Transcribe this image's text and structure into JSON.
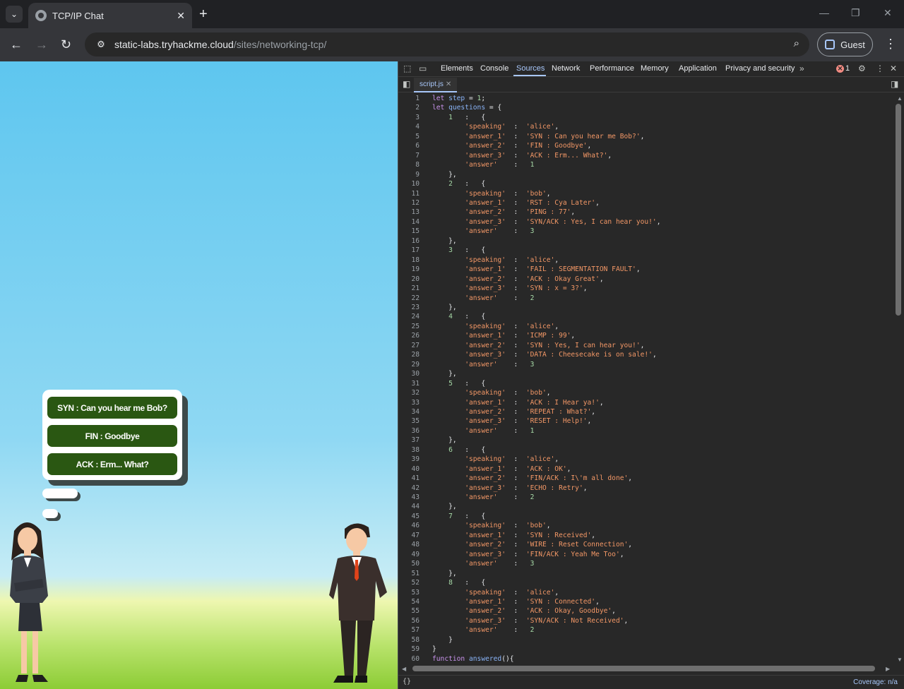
{
  "browser": {
    "tab_title": "TCP/IP Chat",
    "url_host": "static-labs.tryhackme.cloud",
    "url_path": "/sites/networking-tcp/",
    "profile_label": "Guest"
  },
  "chat": {
    "choices": [
      "SYN : Can you hear me Bob?",
      "FIN : Goodbye",
      "ACK : Erm... What?"
    ]
  },
  "devtools": {
    "tabs": [
      "Elements",
      "Console",
      "Sources",
      "Network",
      "Performance",
      "Memory",
      "Application",
      "Privacy and security"
    ],
    "active_tab": "Sources",
    "error_count": "1",
    "file_tab": "script.js",
    "coverage": "Coverage: n/a",
    "pretty_print": "{}"
  },
  "source": {
    "questions": [
      {
        "n": "1",
        "speaking": "alice",
        "a1": "SYN : Can you hear me Bob?",
        "a2": "FIN : Goodbye",
        "a3": "ACK : Erm... What?",
        "answer": "1"
      },
      {
        "n": "2",
        "speaking": "bob",
        "a1": "RST : Cya Later",
        "a2": "PING : 77",
        "a3": "SYN/ACK : Yes, I can hear you!",
        "answer": "3"
      },
      {
        "n": "3",
        "speaking": "alice",
        "a1": "FAIL : SEGMENTATION FAULT",
        "a2": "ACK : Okay Great",
        "a3": "SYN : x = 3?",
        "answer": "2"
      },
      {
        "n": "4",
        "speaking": "alice",
        "a1": "ICMP : 99",
        "a2": "SYN : Yes, I can hear you!",
        "a3": "DATA : Cheesecake is on sale!",
        "answer": "3"
      },
      {
        "n": "5",
        "speaking": "bob",
        "a1": "ACK : I Hear ya!",
        "a2": "REPEAT : What?",
        "a3": "RESET : Help!",
        "answer": "1"
      },
      {
        "n": "6",
        "speaking": "alice",
        "a1": "ACK : OK",
        "a2": "FIN/ACK : I\\'m all done",
        "a3": "ECHO : Retry",
        "answer": "2"
      },
      {
        "n": "7",
        "speaking": "bob",
        "a1": "SYN : Received",
        "a2": "WIRE : Reset Connection",
        "a3": "FIN/ACK : Yeah Me Too",
        "answer": "3"
      },
      {
        "n": "8",
        "speaking": "alice",
        "a1": "SYN : Connected",
        "a2": "ACK : Okay, Goodbye",
        "a3": "SYN/ACK : Not Received",
        "answer": "2"
      }
    ],
    "last_line": "function answered(){"
  }
}
